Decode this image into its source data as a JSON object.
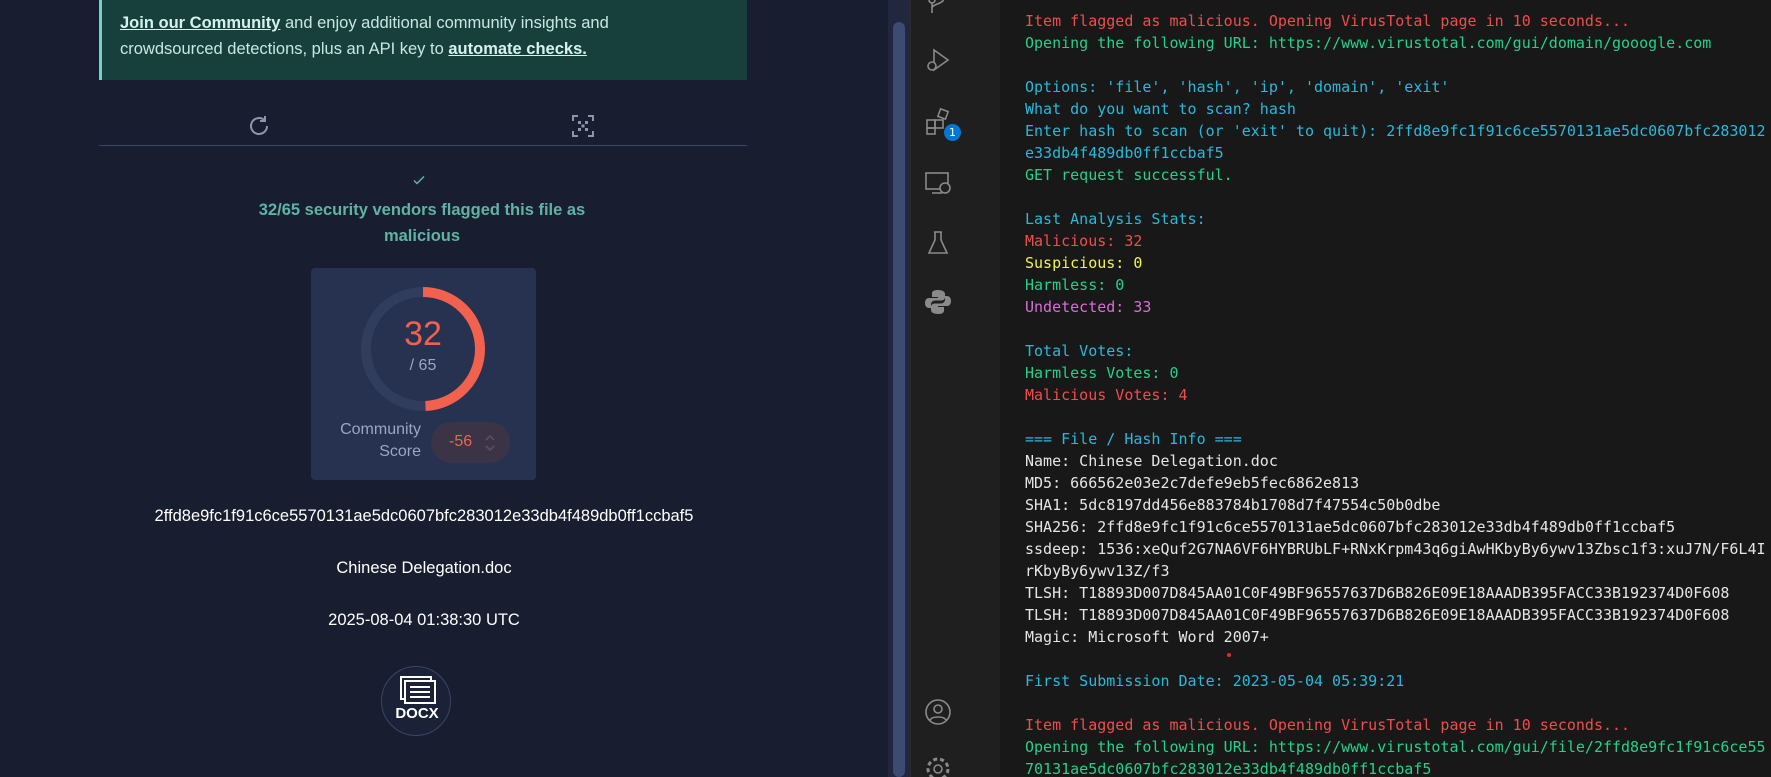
{
  "virustotal": {
    "banner": {
      "join_link": "Join our Community",
      "text_1": " and enjoy additional community insights and",
      "text_2": "crowdsourced detections, plus an API key to ",
      "automate_link": "automate checks."
    },
    "verdict_line_1": "32/65 security vendors flagged this file as",
    "verdict_line_2": "malicious",
    "detection": {
      "malicious": "32",
      "total_label": "/ 65",
      "fraction_flagged": 0.4923
    },
    "community_label_1": "Community",
    "community_label_2": "Score",
    "community_score": "-56",
    "hash": "2ffd8e9fc1f91c6ce5570131ae5dc0607bfc283012e33db4f489db0ff1ccbaf5",
    "filename": "Chinese Delegation.doc",
    "timestamp": "2025-08-04 01:38:30 UTC",
    "filetype_label": "DOCX",
    "icons": [
      "refresh-icon",
      "scan-qr-icon",
      "check-icon",
      "docx-file-icon"
    ]
  },
  "activity_bar": {
    "items": [
      "source-control-icon",
      "run-debug-icon",
      "extensions-icon",
      "remote-explorer-icon",
      "testing-icon",
      "python-icon",
      "account-icon",
      "settings-icon"
    ],
    "extensions_badge": "1"
  },
  "terminal": {
    "lines": [
      {
        "t": "Item flagged as malicious. Opening VirusTotal page in 10 seconds...",
        "c": "red"
      },
      {
        "t": "Opening the following URL: https://www.virustotal.com/gui/domain/gooogle.com",
        "c": "green"
      },
      {
        "t": "",
        "c": "white"
      },
      {
        "t": "Options: 'file', 'hash', 'ip', 'domain', 'exit'",
        "c": "cyan"
      },
      {
        "t": "What do you want to scan? hash",
        "c": "cyan"
      },
      {
        "t": "Enter hash to scan (or 'exit' to quit): 2ffd8e9fc1f91c6ce5570131ae5dc0607bfc283012",
        "c": "cyan"
      },
      {
        "t": "e33db4f489db0ff1ccbaf5",
        "c": "cyan"
      },
      {
        "t": "GET request successful.",
        "c": "green"
      },
      {
        "t": "",
        "c": "white"
      },
      {
        "t": "Last Analysis Stats:",
        "c": "cyan"
      },
      {
        "t": "Malicious: 32",
        "c": "red"
      },
      {
        "t": "Suspicious: 0",
        "c": "yellow"
      },
      {
        "t": "Harmless: 0",
        "c": "green"
      },
      {
        "t": "Undetected: 33",
        "c": "magenta"
      },
      {
        "t": "",
        "c": "white"
      },
      {
        "t": "Total Votes:",
        "c": "cyan"
      },
      {
        "t": "Harmless Votes: 0",
        "c": "green"
      },
      {
        "t": "Malicious Votes: 4",
        "c": "red"
      },
      {
        "t": "",
        "c": "white"
      },
      {
        "t": "=== File / Hash Info ===",
        "c": "cyan"
      },
      {
        "t": "Name: Chinese Delegation.doc",
        "c": "white"
      },
      {
        "t": "MD5: 666562e03e2c7defe9eb5fec6862e813",
        "c": "white"
      },
      {
        "t": "SHA1: 5dc8197dd456e883784b1708d7f47554c50b0dbe",
        "c": "white"
      },
      {
        "t": "SHA256: 2ffd8e9fc1f91c6ce5570131ae5dc0607bfc283012e33db4f489db0ff1ccbaf5",
        "c": "white"
      },
      {
        "t": "ssdeep: 1536:xeQuf2G7NA6VF6HYBRUbLF+RNxKrpm43q6giAwHKbyBy6ywv13Zbsc1f3:xuJ7N/F6L4I",
        "c": "white"
      },
      {
        "t": "rKbyBy6ywv13Z/f3",
        "c": "white"
      },
      {
        "t": "TLSH: T18893D007D845AA01C0F49BF96557637D6B826E09E18AAADB395FACC33B192374D0F608",
        "c": "white"
      },
      {
        "t": "TLSH: T18893D007D845AA01C0F49BF96557637D6B826E09E18AAADB395FACC33B192374D0F608",
        "c": "white"
      },
      {
        "t": "Magic: Microsoft Word 2007+",
        "c": "white"
      },
      {
        "t": "",
        "c": "white"
      },
      {
        "t": "First Submission Date: 2023-05-04 05:39:21",
        "c": "cyan"
      },
      {
        "t": "",
        "c": "white"
      },
      {
        "t": "Item flagged as malicious. Opening VirusTotal page in 10 seconds...",
        "c": "red"
      },
      {
        "t": "Opening the following URL: https://www.virustotal.com/gui/file/2ffd8e9fc1f91c6ce55",
        "c": "green"
      },
      {
        "t": "70131ae5dc0607bfc283012e33db4f489db0ff1ccbaf5",
        "c": "green"
      }
    ]
  },
  "colors": {
    "vt_background": "#181e30",
    "banner_background": "#17403d",
    "malicious_red": "#f2614e",
    "verdict_teal": "#5fb3a3",
    "terminal_background": "#181818"
  }
}
